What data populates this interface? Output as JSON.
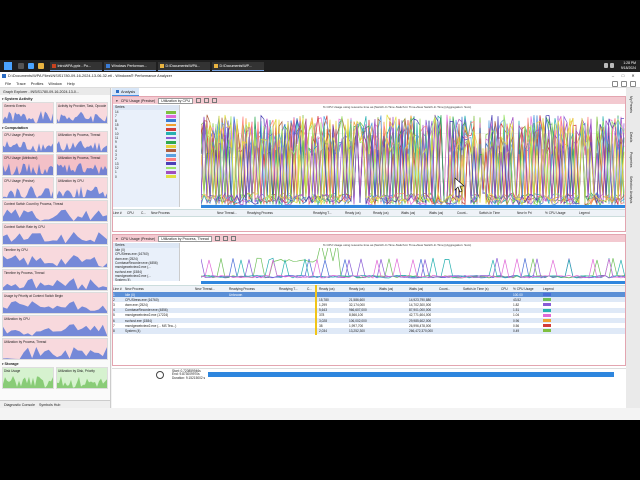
{
  "taskbar": {
    "apps": [
      {
        "label": "IntroWPA.pptx - Po...",
        "icon": "powerpoint-icon",
        "color": "#c8431f"
      },
      {
        "label": "Windows Performan...",
        "icon": "wpa-icon",
        "color": "#3a7bd5"
      },
      {
        "label": "D:\\Documents\\WPA...",
        "icon": "folder-icon",
        "color": "#e8b340"
      },
      {
        "label": "D:\\Documents\\WP...",
        "icon": "folder-icon",
        "color": "#e8b340"
      }
    ],
    "clock": {
      "time": "1:28 PM",
      "date": "9/18/2024"
    }
  },
  "window": {
    "title": "D:\\Documents\\WPA Files\\INSIS1780-09-16-2024-13-06-32.etl - Windows® Performance Analyzer"
  },
  "menu": [
    "File",
    "Trace",
    "Profiles",
    "Window",
    "Help"
  ],
  "graph_explorer": {
    "tab_label": "Graph Explorer - INSIS1780-09-16-2024-13-0...",
    "groups": [
      {
        "title": "System Activity",
        "thumbs": [
          {
            "label": "Generic Events",
            "style": "pink"
          },
          {
            "label": "Activity by Provider, Task, Opcode",
            "style": "pink"
          }
        ]
      },
      {
        "title": "Computation",
        "thumbs": [
          {
            "label": "CPU Usage (Precise)",
            "style": "pink"
          },
          {
            "label": "Utilization by Process, Thread",
            "style": "pink"
          }
        ]
      },
      {
        "title": "",
        "thumbs": [
          {
            "label": "CPU Usage (Attributed)",
            "style": "red"
          },
          {
            "label": "Utilization by Process, Thread",
            "style": "red"
          }
        ]
      },
      {
        "title": "",
        "thumbs": [
          {
            "label": "CPU Usage (Precise)",
            "style": "pink"
          },
          {
            "label": "Utilization by CPU",
            "style": "pink"
          }
        ]
      },
      {
        "title": "",
        "thumbs": [
          {
            "label": "Context Switch Count by Process, Thread",
            "style": "pink"
          }
        ]
      },
      {
        "title": "",
        "thumbs": [
          {
            "label": "Context Switch Rate by CPU",
            "style": "pink"
          }
        ]
      },
      {
        "title": "",
        "thumbs": [
          {
            "label": "Timeline by CPU",
            "style": "pink"
          }
        ]
      },
      {
        "title": "",
        "thumbs": [
          {
            "label": "Timeline by Process, Thread",
            "style": "pink"
          }
        ]
      },
      {
        "title": "",
        "thumbs": [
          {
            "label": "Usage by Priority at Context Switch Begin",
            "style": "pink"
          }
        ]
      },
      {
        "title": "",
        "thumbs": [
          {
            "label": "Utilization by CPU",
            "style": "pink"
          }
        ]
      },
      {
        "title": "",
        "thumbs": [
          {
            "label": "Utilization by Process, Thread",
            "style": "pink"
          }
        ]
      },
      {
        "title": "Storage",
        "thumbs": [
          {
            "label": "Disk Usage",
            "style": "green"
          },
          {
            "label": "Utilization by Disk, Priority",
            "style": "green"
          }
        ]
      }
    ],
    "footer": [
      "Diagnostic Console",
      "Symbols Hub"
    ]
  },
  "side_tabs": [
    "My Presets",
    "Details",
    "Properties",
    "Selection Analysis"
  ],
  "analysis": {
    "tab_label": "Analysis",
    "top_panel": {
      "graph_name": "CPU Usage (Precise)",
      "preset": "Utilization by CPU",
      "chart_title": "% CPU Usage using resource time as [Switch-In Time-Switch-In Time+New Switch-In Time] (Aggregation: Sum)",
      "series_header": "Series",
      "series": [
        {
          "name": "14",
          "color": "#7fbf3f"
        },
        {
          "name": "7",
          "color": "#e06ad7"
        },
        {
          "name": "8",
          "color": "#3a7bd5"
        },
        {
          "name": "15",
          "color": "#f0a030"
        },
        {
          "name": "5",
          "color": "#d23b3b"
        },
        {
          "name": "10",
          "color": "#27b0b0"
        },
        {
          "name": "11",
          "color": "#8a5cd6"
        },
        {
          "name": "9",
          "color": "#2fa84f"
        },
        {
          "name": "6",
          "color": "#e7d23a"
        },
        {
          "name": "4",
          "color": "#b06040"
        },
        {
          "name": "3",
          "color": "#5aa0e0"
        },
        {
          "name": "2",
          "color": "#ff7f7f"
        },
        {
          "name": "13",
          "color": "#4b3fb5"
        },
        {
          "name": "12",
          "color": "#9be36a"
        },
        {
          "name": "1",
          "color": "#a04fbf"
        },
        {
          "name": "0",
          "color": "#e0e040"
        }
      ],
      "columns": [
        "Line #",
        "CPU",
        "C...",
        "New Process",
        "New Thread...",
        "Readying Process",
        "Readying T...",
        "Ready (us)",
        "Ready (us)",
        "Waits (us)",
        "Waits (us)",
        "Count...",
        "Switch-In Time",
        "New In Pri",
        "% CPU Usage",
        "Legend"
      ]
    },
    "bottom_panel": {
      "graph_name": "CPU Usage (Precise)",
      "preset": "Utilization by Process, Thread",
      "chart_title": "% CPU Usage using resource time as [Switch-In Time-Switch-In Time+New Switch-In Time] (Aggregation: Sum)",
      "series_header": "Series",
      "series": [
        {
          "name": "Idle (0)"
        },
        {
          "name": "CPUStress.exe (16760)"
        },
        {
          "name": "dwm.exe (2524)"
        },
        {
          "name": "CombaseRecorder.exe (4856)"
        },
        {
          "name": "msedgewebview2.exe (..."
        },
        {
          "name": "svchost.exe (1584)"
        },
        {
          "name": "msedgewebview2.exe (..."
        },
        {
          "name": "System (4)"
        }
      ],
      "columns": [
        "Line #",
        "New Process",
        "New Thread...",
        "Readying Process",
        "Readying T...",
        "C...",
        "Ready (us)",
        "Ready (us)",
        "Waits (us)",
        "Waits (us)",
        "Count...",
        "Switch-In Time (s)",
        "CPU",
        "% CPU Usage",
        "Legend"
      ],
      "rows": [
        {
          "line": "1",
          "proc": "Idle (0)",
          "ready_proc": "Unknown",
          "count": "",
          "ready": "",
          "waits": "",
          "pct": "100.00",
          "cls": "sel"
        },
        {
          "line": "2",
          "proc": "CPUStress.exe (16760)",
          "ready_proc": "",
          "count": "15,780",
          "ready": "21,586,600",
          "waits": "14,923,790,880",
          "pct": "43.52",
          "cls": "alt"
        },
        {
          "line": "3",
          "proc": "dwm.exe (2524)",
          "ready_proc": "",
          "count": "1,299",
          "ready": "32,174,000",
          "waits": "14,702,300,000",
          "pct": "1.82",
          "cls": ""
        },
        {
          "line": "4",
          "proc": "CombaseRecorder.exe (4856)",
          "ready_proc": "",
          "count": "5,643",
          "ready": "966,607,000",
          "waits": "87,901,000,000",
          "pct": "1.51",
          "cls": "alt"
        },
        {
          "line": "5",
          "proc": "msedgewebview2.exe (17224)",
          "ready_proc": "",
          "count": "378",
          "ready": "8,566,100",
          "waits": "42,771,604,000",
          "pct": "1.04",
          "cls": ""
        },
        {
          "line": "6",
          "proc": "svchost.exe (1584)",
          "ready_proc": "",
          "count": "3,028",
          "ready": "106,002,000",
          "waits": "29,985,602,000",
          "pct": "0.96",
          "cls": "alt"
        },
        {
          "line": "7",
          "proc": "msedgewebview2.exe (... MS Tea...)",
          "ready_proc": "",
          "count": "38",
          "ready": "1,997,700",
          "waits": "26,996,478,000",
          "pct": "0.56",
          "cls": ""
        },
        {
          "line": "8",
          "proc": "System (4)",
          "ready_proc": "",
          "count": "2,034",
          "ready": "13,252,300",
          "waits": "266,472,370,000",
          "pct": "0.49",
          "cls": "alt"
        }
      ]
    },
    "timeline_label": "0 Timeline",
    "footer": {
      "start": "Start: 0.720859946s",
      "end": "End: 9.873009970s",
      "duration": "Duration: 9.15215002 s"
    }
  },
  "colors": {
    "accent": "#2e86de",
    "graph_header": "#f3c9d0",
    "selection": "#5b8fd6"
  }
}
